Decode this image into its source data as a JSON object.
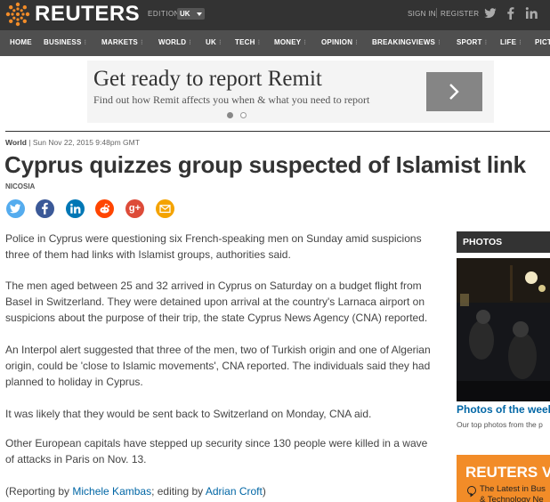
{
  "topbar": {
    "logo_text": "REUTERS",
    "edition_label": "EDITION:",
    "edition_value": "UK",
    "signin": "SIGN IN",
    "register": "REGISTER",
    "social_icons": [
      "twitter-icon",
      "facebook-icon",
      "linkedin-icon"
    ]
  },
  "nav": {
    "items": [
      "HOME",
      "BUSINESS",
      "MARKETS",
      "WORLD",
      "UK",
      "TECH",
      "MONEY",
      "OPINION",
      "BREAKINGVIEWS",
      "SPORT",
      "LIFE",
      "PICT"
    ]
  },
  "ad": {
    "title": "Get ready to report Remit",
    "subtitle": "Find out how Remit affects you when & what you need to report",
    "next_icon": "chevron-right-icon"
  },
  "article": {
    "section": "World",
    "date": "Sun Nov 22, 2015 9:48pm GMT",
    "headline": "Cyprus quizzes group suspected of Islamist link",
    "location": "NICOSIA",
    "share_icons": [
      "twitter-icon",
      "facebook-icon",
      "linkedin-icon",
      "reddit-icon",
      "google-plus-icon",
      "email-icon"
    ],
    "paragraphs": [
      "Police in Cyprus were questioning six French-speaking men on Sunday amid suspicions three of them had links with Islamist groups, authorities said.",
      "The men aged between 25 and 32 arrived in Cyprus on Saturday on a budget flight from Basel in Switzerland. They were detained upon arrival at the country's Larnaca airport on suspicions about the purpose of their trip, the state Cyprus News Agency (CNA) reported.",
      "An Interpol alert suggested that three of the men, two of Turkish origin and one of Algerian origin, could be 'close to Islamic movements', CNA reported. The individuals said they had planned to holiday in Cyprus.",
      "It was likely that they would be sent back to Switzerland on Monday, CNA aid.",
      "Other European capitals have stepped up security since 130 people were killed in a wave of attacks in Paris on Nov. 13."
    ],
    "credit_prefix": "(Reporting by ",
    "credit_reporter": "Michele Kambas",
    "credit_mid": "; editing by ",
    "credit_editor": "Adrian Croft",
    "credit_suffix": ")"
  },
  "sidebar": {
    "photos_heading": "PHOTOS",
    "photo_title": "Photos of the week",
    "photo_desc": "Our top photos from the p",
    "promo_title": "REUTERS V",
    "promo_line1": "The Latest in Bus",
    "promo_line2": "& Technology Ne"
  },
  "colors": {
    "topbar": "#333333",
    "navbar": "#4f4f4f",
    "link": "#0066a5",
    "brand_orange": "#f28c28",
    "twitter": "#55acee",
    "facebook": "#3b5998",
    "linkedin": "#0077b5",
    "reddit": "#ff4500",
    "google_plus": "#dd4b39",
    "email": "#f4a300"
  }
}
